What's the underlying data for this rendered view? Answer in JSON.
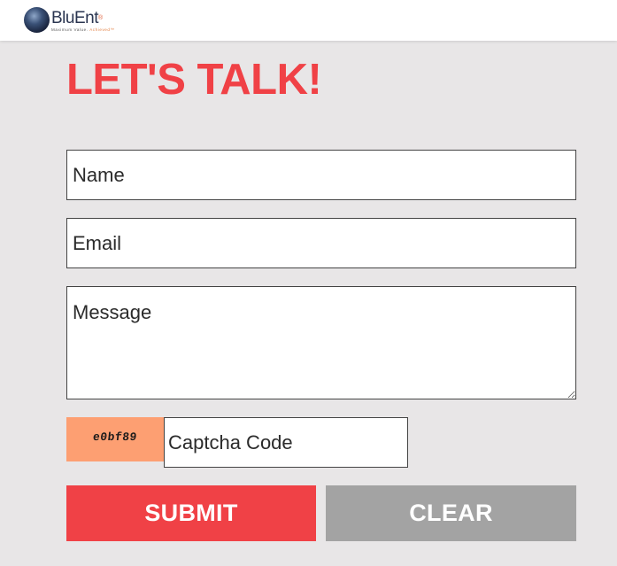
{
  "header": {
    "brand": "BluEnt",
    "registered": "®",
    "tagline_prefix": "Maximum Value.",
    "tagline_highlight": "Achieved™"
  },
  "form": {
    "title": "LET'S TALK!",
    "name_placeholder": "Name",
    "email_placeholder": "Email",
    "message_placeholder": "Message",
    "captcha_code": "e0bf89",
    "captcha_placeholder": "Captcha Code",
    "submit_label": "SUBMIT",
    "clear_label": "CLEAR"
  },
  "colors": {
    "accent": "#f04146",
    "captcha_bg": "#fd9f72",
    "clear_button": "#a3a3a3",
    "page_bg": "#e8e6e7"
  }
}
